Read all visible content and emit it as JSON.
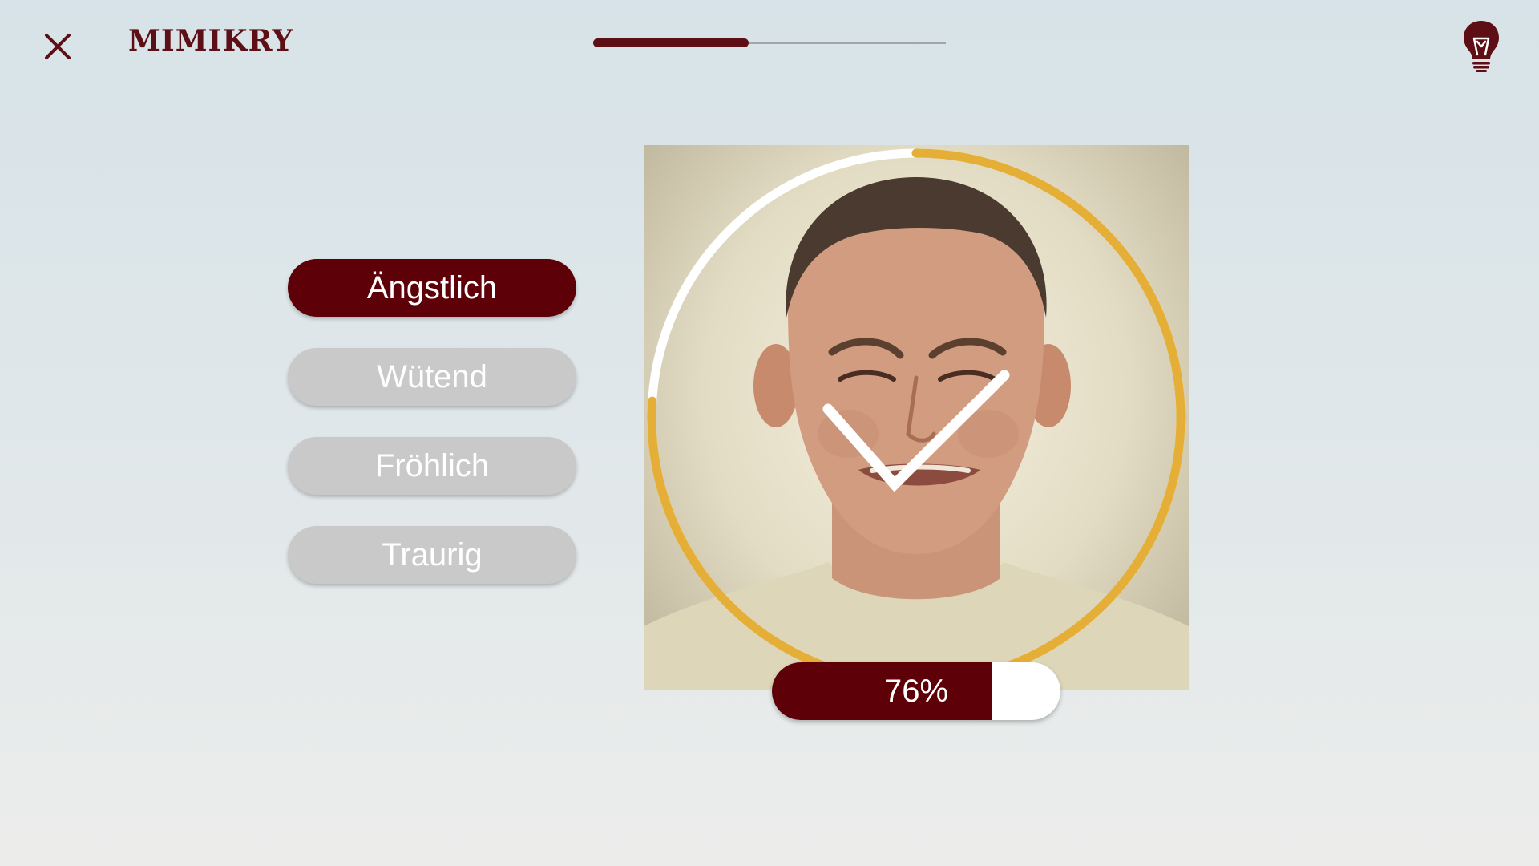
{
  "header": {
    "title": "MIMIKRY",
    "close_icon": "close-icon",
    "hint_icon": "lightbulb-icon",
    "progress": 0.44
  },
  "answers": [
    {
      "label": "Ängstlich",
      "selected": true
    },
    {
      "label": "Wütend",
      "selected": false
    },
    {
      "label": "Fröhlich",
      "selected": false
    },
    {
      "label": "Traurig",
      "selected": false
    }
  ],
  "result": {
    "score_label": "76%",
    "score": 0.76,
    "ring_progress": 0.76,
    "check_icon": "checkmark-icon"
  },
  "colors": {
    "brand": "#5e0f16",
    "selected": "#5e0008",
    "unselected": "#c9c9c9",
    "ring_fill": "#e5ae36",
    "ring_track": "#ffffff"
  }
}
